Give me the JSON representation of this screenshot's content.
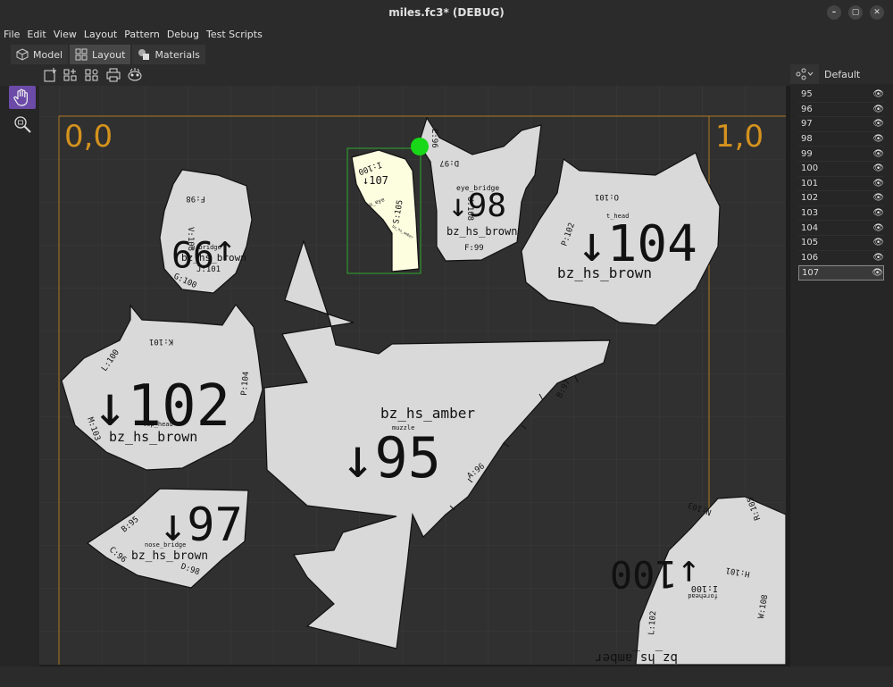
{
  "window": {
    "title": "miles.fc3* (DEBUG)"
  },
  "menu": {
    "items": [
      "File",
      "Edit",
      "View",
      "Layout",
      "Pattern",
      "Debug",
      "Test Scripts"
    ]
  },
  "tabs": [
    {
      "label": "Model"
    },
    {
      "label": "Layout"
    },
    {
      "label": "Materials"
    }
  ],
  "right_panel": {
    "preset": "Default",
    "layers": [
      "95",
      "96",
      "97",
      "98",
      "99",
      "100",
      "101",
      "102",
      "103",
      "104",
      "105",
      "106",
      "107"
    ],
    "selected_layer": "107"
  },
  "canvas": {
    "corner_left": "0,0",
    "corner_right": "1,0",
    "colors": {
      "piece_fill": "#d9d9d9",
      "selected_fill": "#fdfde0",
      "page_border": "#b07820",
      "handle": "#18d818",
      "selection": "#2ea82e",
      "tool_active": "#6b4aa8"
    },
    "pieces": [
      {
        "big_label": "↓95",
        "material": "bz_hs_amber",
        "name": "muzzle",
        "edges": [
          "A:96",
          "B:97"
        ]
      },
      {
        "big_label": "↓97",
        "material": "bz_hs_brown",
        "name": "nose_bridge",
        "edges": [
          "B:95",
          "C:96",
          "D:98"
        ]
      },
      {
        "big_label": "↓98",
        "material": "bz_hs_brown",
        "name": "eye_bridge",
        "edges": [
          "D:97",
          "E:96",
          "F:99",
          "U:108"
        ]
      },
      {
        "big_label": "↓99",
        "material": "bz_hs_brown",
        "name": "u_bridge",
        "edges": [
          "F:98",
          "G:100",
          "J:101",
          "V:108"
        ]
      },
      {
        "big_label": "↓100",
        "material": "bz_hs_amber",
        "name": "forehead",
        "edges": [
          "N:103",
          "R:105",
          "H:101",
          "W:108",
          "L:102"
        ]
      },
      {
        "big_label": "↓102",
        "material": "bz_hs_brown",
        "name": "top_head",
        "edges": [
          "K:101",
          "L:100",
          "M:103",
          "P:104"
        ]
      },
      {
        "big_label": "↓104",
        "material": "bz_hs_brown",
        "name": "t_head",
        "edges": [
          "O:101",
          "P:102"
        ]
      },
      {
        "big_label": "↓107",
        "material": "",
        "name": "u_eye",
        "edges": [
          "I:100",
          "S:105"
        ],
        "small_text": "bz_hs_amber"
      }
    ]
  }
}
